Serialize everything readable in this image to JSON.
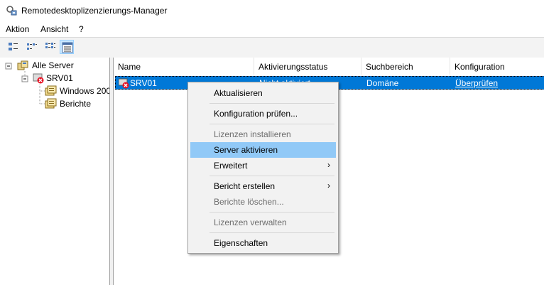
{
  "window": {
    "title": "Remotedesktoplizenzierungs-Manager"
  },
  "menu": [
    "Aktion",
    "Ansicht",
    "?"
  ],
  "toolbar": {
    "buttons": [
      "large-icons-view-icon",
      "small-icons-view-icon",
      "list-view-icon",
      "details-view-icon"
    ],
    "active": 3
  },
  "tree": {
    "root": "Alle Server",
    "server": "SRV01",
    "children": [
      "Windows 200",
      "Berichte"
    ]
  },
  "list": {
    "columns": [
      "Name",
      "Aktivierungsstatus",
      "Suchbereich",
      "Konfiguration"
    ],
    "rows": [
      {
        "name": "SRV01",
        "status": "Nicht aktiviert",
        "scope": "Domäne",
        "config": "Überprüfen"
      }
    ]
  },
  "context_menu": {
    "items": [
      {
        "label": "Aktualisieren",
        "enabled": true
      },
      {
        "label": "Konfiguration prüfen...",
        "enabled": true
      },
      {
        "label": "Lizenzen installieren",
        "enabled": false
      },
      {
        "label": "Server aktivieren",
        "enabled": true,
        "highlighted": true
      },
      {
        "label": "Erweitert",
        "enabled": true,
        "submenu": true
      },
      {
        "label": "Bericht erstellen",
        "enabled": true,
        "submenu": true
      },
      {
        "label": "Berichte löschen...",
        "enabled": false
      },
      {
        "label": "Lizenzen verwalten",
        "enabled": false
      },
      {
        "label": "Eigenschaften",
        "enabled": true
      }
    ],
    "submenu_glyph": "›"
  },
  "colors": {
    "selection": "#0078d7",
    "menu_hover": "#91c9f7",
    "menu_bg": "#f2f2f2"
  }
}
